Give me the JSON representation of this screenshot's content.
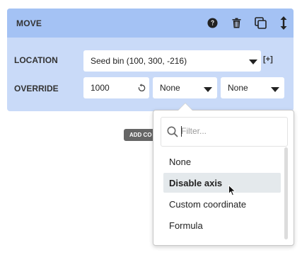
{
  "card": {
    "title": "MOVE",
    "header_icons": [
      "help-icon",
      "trash-icon",
      "duplicate-icon",
      "drag-handle-icon"
    ]
  },
  "location": {
    "label": "LOCATION",
    "value": "Seed bin (100, 300, -216)",
    "add_label": "[+]"
  },
  "override": {
    "label": "OVERRIDE",
    "speed_value": "1000",
    "axis_select_1": "None",
    "axis_select_2": "None"
  },
  "add_condition": {
    "label": "ADD CO"
  },
  "dropdown": {
    "filter_placeholder": "Filter...",
    "options": [
      "None",
      "Disable axis",
      "Custom coordinate",
      "Formula"
    ],
    "selected": "Disable axis"
  },
  "colors": {
    "card_background": "#c9daf8",
    "card_header": "#a4c2f4",
    "selected_option": "#e4e9ec"
  }
}
